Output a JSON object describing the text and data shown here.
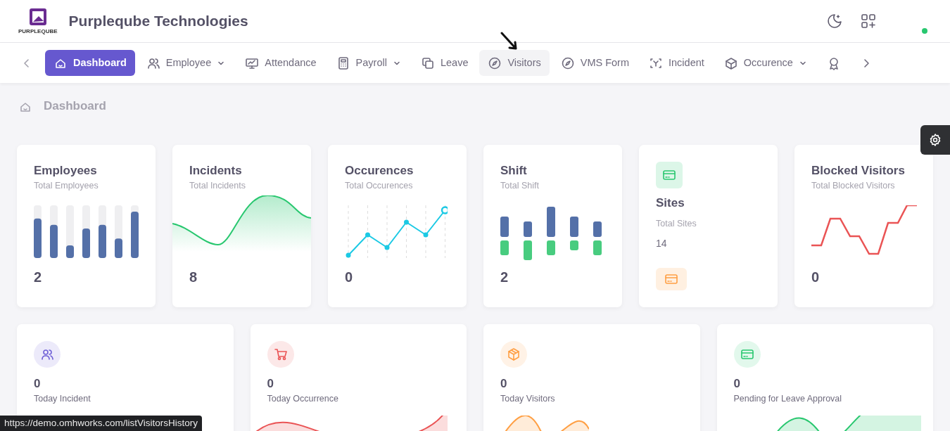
{
  "header": {
    "company": "Purpleqube Technologies",
    "logo_text": "PURPLEQUBE",
    "status_online": true
  },
  "nav": [
    {
      "label": "Dashboard",
      "dropdown": false,
      "selected": true,
      "hovered": false
    },
    {
      "label": "Employee",
      "dropdown": true,
      "selected": false,
      "hovered": false
    },
    {
      "label": "Attendance",
      "dropdown": false,
      "selected": false,
      "hovered": false
    },
    {
      "label": "Payroll",
      "dropdown": true,
      "selected": false,
      "hovered": false
    },
    {
      "label": "Leave",
      "dropdown": false,
      "selected": false,
      "hovered": false
    },
    {
      "label": "Visitors",
      "dropdown": false,
      "selected": false,
      "hovered": true
    },
    {
      "label": "VMS Form",
      "dropdown": false,
      "selected": false,
      "hovered": false
    },
    {
      "label": "Incident",
      "dropdown": false,
      "selected": false,
      "hovered": false
    },
    {
      "label": "Occurence",
      "dropdown": true,
      "selected": false,
      "hovered": false
    },
    {
      "dropdown": false,
      "selected": false,
      "hovered": false
    }
  ],
  "breadcrumb": "Dashboard",
  "stat_cards": [
    {
      "kind": "bars",
      "title": "Employees",
      "subtitle": "Total Employees",
      "value": "2"
    },
    {
      "kind": "area",
      "title": "Incidents",
      "subtitle": "Total Incidents",
      "value": "8"
    },
    {
      "kind": "line",
      "title": "Occurences",
      "subtitle": "Total Occurences",
      "value": "0"
    },
    {
      "kind": "split",
      "title": "Shift",
      "subtitle": "Total Shift",
      "value": "2"
    },
    {
      "kind": "tile",
      "title": "Sites",
      "subtitle": "Total Sites",
      "value": "14"
    },
    {
      "kind": "step",
      "title": "Blocked Visitors",
      "subtitle": "Total Blocked Visitors",
      "value": "0"
    }
  ],
  "today_cards": [
    {
      "color": "#6f5fd6",
      "value": "0",
      "label": "Today Incident"
    },
    {
      "color": "#ea5455",
      "value": "0",
      "label": "Today Occurrence"
    },
    {
      "color": "#ff9f43",
      "value": "0",
      "label": "Today Visitors"
    },
    {
      "color": "#28c76f",
      "value": "0",
      "label": "Pending for Leave Approval"
    }
  ],
  "status_bar": "https://demo.omhworks.com/listVisitorsHistory"
}
